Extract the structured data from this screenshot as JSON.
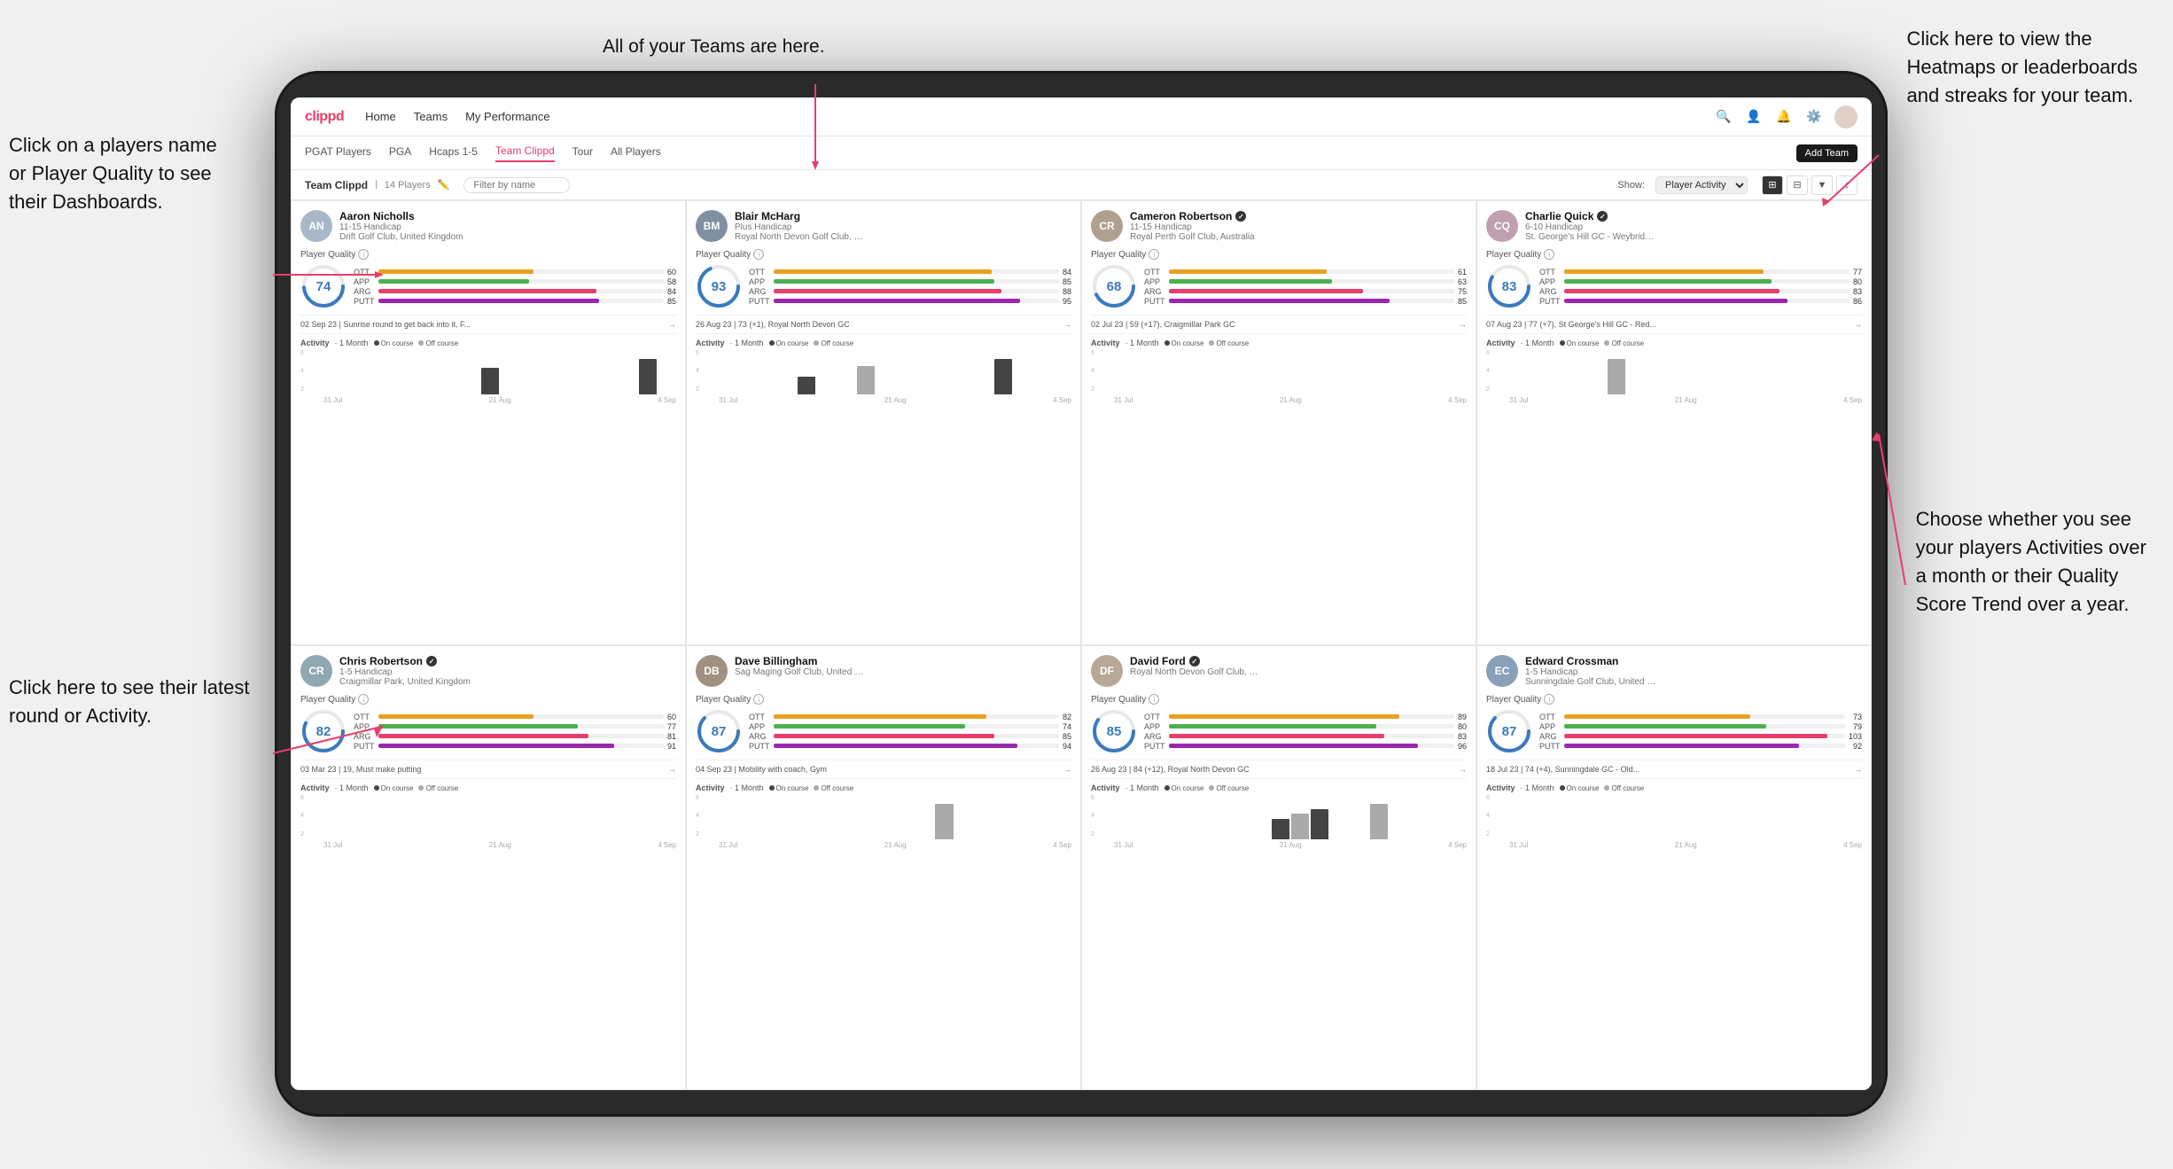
{
  "annotations": {
    "top_teams": "All of your Teams are here.",
    "top_right": "Click here to view the\nHeatmaps or leaderboards\nand streaks for your team.",
    "left_click": "Click on a players name\nor Player Quality to see\ntheir Dashboards.",
    "bottom_left": "Click here to see their latest\nround or Activity.",
    "right_choose": "Choose whether you see\nyour players Activities over\na month or their Quality\nScore Trend over a year."
  },
  "nav": {
    "logo": "clippd",
    "items": [
      "Home",
      "Teams",
      "My Performance"
    ],
    "icons": [
      "search",
      "person",
      "bell",
      "settings",
      "avatar"
    ]
  },
  "sub_nav": {
    "items": [
      "PGAT Players",
      "PGA",
      "Hcaps 1-5",
      "Team Clippd",
      "Tour",
      "All Players"
    ],
    "active": "Team Clippd",
    "add_button": "Add Team"
  },
  "team_header": {
    "title": "Team Clippd",
    "count": "14 Players",
    "filter_placeholder": "Filter by name",
    "show_label": "Show:",
    "show_option": "Player Activity",
    "views": [
      "grid2",
      "grid3",
      "filter",
      "sort"
    ]
  },
  "players": [
    {
      "name": "Aaron Nicholls",
      "handicap": "11-15 Handicap",
      "club": "Drift Golf Club, United Kingdom",
      "score": 74,
      "score_color": "#3a7abf",
      "ott": 60,
      "app": 58,
      "arg": 84,
      "putt": 85,
      "latest_round": "02 Sep 23 | Sunrise round to get back into it, F...",
      "avatar_color": "#a8b8c8",
      "bars": [
        {
          "color": "#e8a020",
          "pct": 50
        },
        {
          "color": "#4caf50",
          "pct": 49
        },
        {
          "color": "#e83e6c",
          "pct": 71
        },
        {
          "color": "#9c27b0",
          "pct": 72
        }
      ],
      "chart_bars": [
        0,
        0,
        0,
        0,
        0,
        0,
        0,
        0,
        3,
        0,
        0,
        0,
        0,
        0,
        0,
        0,
        4,
        0
      ]
    },
    {
      "name": "Blair McHarg",
      "handicap": "Plus Handicap",
      "club": "Royal North Devon Golf Club, United Kin...",
      "score": 93,
      "score_color": "#3a7abf",
      "ott": 84,
      "app": 85,
      "arg": 88,
      "putt": 95,
      "latest_round": "26 Aug 23 | 73 (+1), Royal North Devon GC",
      "avatar_color": "#8090a0",
      "bars": [
        {
          "color": "#e8a020",
          "pct": 71
        },
        {
          "color": "#4caf50",
          "pct": 72
        },
        {
          "color": "#e83e6c",
          "pct": 75
        },
        {
          "color": "#9c27b0",
          "pct": 81
        }
      ],
      "chart_bars": [
        0,
        0,
        0,
        0,
        5,
        0,
        0,
        8,
        0,
        0,
        0,
        0,
        0,
        0,
        10,
        0,
        0,
        0
      ]
    },
    {
      "name": "Cameron Robertson",
      "verified": true,
      "handicap": "11-15 Handicap",
      "club": "Royal Perth Golf Club, Australia",
      "score": 68,
      "score_color": "#3a7abf",
      "ott": 61,
      "app": 63,
      "arg": 75,
      "putt": 85,
      "latest_round": "02 Jul 23 | 59 (+17), Craigmillar Park GC",
      "avatar_color": "#b0a090",
      "bars": [
        {
          "color": "#e8a020",
          "pct": 52
        },
        {
          "color": "#4caf50",
          "pct": 53
        },
        {
          "color": "#e83e6c",
          "pct": 63
        },
        {
          "color": "#9c27b0",
          "pct": 72
        }
      ],
      "chart_bars": [
        0,
        0,
        0,
        0,
        0,
        0,
        0,
        0,
        0,
        0,
        0,
        0,
        0,
        0,
        0,
        0,
        0,
        0
      ]
    },
    {
      "name": "Charlie Quick",
      "verified": true,
      "handicap": "6-10 Handicap",
      "club": "St. George's Hill GC - Weybridge - Surrey...",
      "score": 83,
      "score_color": "#3a7abf",
      "ott": 77,
      "app": 80,
      "arg": 83,
      "putt": 86,
      "latest_round": "07 Aug 23 | 77 (+7), St George's Hill GC - Red...",
      "avatar_color": "#c0a0b0",
      "bars": [
        {
          "color": "#e8a020",
          "pct": 65
        },
        {
          "color": "#4caf50",
          "pct": 68
        },
        {
          "color": "#e83e6c",
          "pct": 70
        },
        {
          "color": "#9c27b0",
          "pct": 73
        }
      ],
      "chart_bars": [
        0,
        0,
        0,
        0,
        0,
        5,
        0,
        0,
        0,
        0,
        0,
        0,
        0,
        0,
        0,
        0,
        0,
        0
      ]
    },
    {
      "name": "Chris Robertson",
      "verified": true,
      "handicap": "1-5 Handicap",
      "club": "Craigmillar Park, United Kingdom",
      "score": 82,
      "score_color": "#3a7abf",
      "ott": 60,
      "app": 77,
      "arg": 81,
      "putt": 91,
      "latest_round": "03 Mar 23 | 19, Must make putting",
      "avatar_color": "#90a8b0",
      "bars": [
        {
          "color": "#e8a020",
          "pct": 50
        },
        {
          "color": "#4caf50",
          "pct": 65
        },
        {
          "color": "#e83e6c",
          "pct": 68
        },
        {
          "color": "#9c27b0",
          "pct": 77
        }
      ],
      "chart_bars": [
        0,
        0,
        0,
        0,
        0,
        0,
        0,
        0,
        0,
        0,
        0,
        0,
        0,
        0,
        0,
        0,
        0,
        0
      ]
    },
    {
      "name": "Dave Billingham",
      "handicap": "",
      "club": "Sag Maging Golf Club, United Kingdom",
      "score": 87,
      "score_color": "#3a7abf",
      "ott": 82,
      "app": 74,
      "arg": 85,
      "putt": 94,
      "latest_round": "04 Sep 23 | Mobility with coach, Gym",
      "avatar_color": "#a09080",
      "bars": [
        {
          "color": "#e8a020",
          "pct": 69
        },
        {
          "color": "#4caf50",
          "pct": 63
        },
        {
          "color": "#e83e6c",
          "pct": 72
        },
        {
          "color": "#9c27b0",
          "pct": 80
        }
      ],
      "chart_bars": [
        0,
        0,
        0,
        0,
        0,
        0,
        0,
        0,
        0,
        0,
        0,
        6,
        0,
        0,
        0,
        0,
        0,
        0
      ]
    },
    {
      "name": "David Ford",
      "verified": true,
      "handicap": "",
      "club": "Royal North Devon Golf Club, United Kin...",
      "score": 85,
      "score_color": "#3a7abf",
      "ott": 89,
      "app": 80,
      "arg": 83,
      "putt": 96,
      "latest_round": "26 Aug 23 | 84 (+12), Royal North Devon GC",
      "avatar_color": "#b8a898",
      "bars": [
        {
          "color": "#e8a020",
          "pct": 75
        },
        {
          "color": "#4caf50",
          "pct": 68
        },
        {
          "color": "#e83e6c",
          "pct": 70
        },
        {
          "color": "#9c27b0",
          "pct": 81
        }
      ],
      "chart_bars": [
        0,
        0,
        0,
        0,
        0,
        0,
        0,
        0,
        8,
        10,
        12,
        0,
        0,
        14,
        0,
        0,
        0,
        0
      ]
    },
    {
      "name": "Edward Crossman",
      "handicap": "1-5 Handicap",
      "club": "Sunningdale Golf Club, United Kingdom",
      "score": 87,
      "score_color": "#3a7abf",
      "ott": 73,
      "app": 79,
      "arg": 103,
      "putt": 92,
      "latest_round": "18 Jul 23 | 74 (+4), Sunningdale GC - Old...",
      "avatar_color": "#88a0b8",
      "bars": [
        {
          "color": "#e8a020",
          "pct": 62
        },
        {
          "color": "#4caf50",
          "pct": 67
        },
        {
          "color": "#e83e6c",
          "pct": 87
        },
        {
          "color": "#9c27b0",
          "pct": 78
        }
      ],
      "chart_bars": [
        0,
        0,
        0,
        0,
        0,
        0,
        0,
        0,
        0,
        0,
        0,
        0,
        0,
        0,
        0,
        0,
        0,
        0
      ]
    }
  ],
  "activity": {
    "title": "Activity",
    "period": "· 1 Month",
    "on_course": "On course",
    "off_course": "Off course"
  },
  "chart_dates": [
    "31 Jul",
    "21 Aug",
    "4 Sep"
  ]
}
